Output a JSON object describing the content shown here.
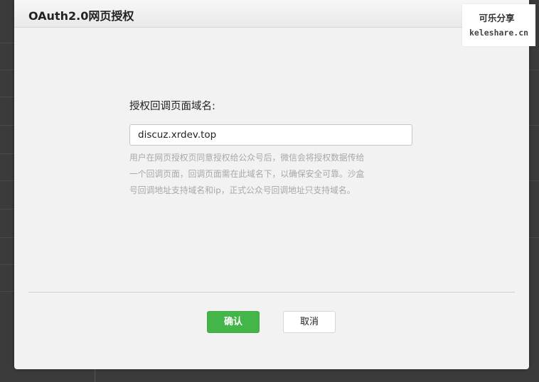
{
  "dialog": {
    "title": "OAuth2.0网页授权"
  },
  "watermark": {
    "line1": "可乐分享",
    "line2": "keleshare.cn"
  },
  "form": {
    "label": "授权回调页面域名:",
    "domain_value": "discuz.xrdev.top",
    "help_lines": [
      "用户在网页授权页同意授权给公众号后，微信会将授权数据传给",
      "一个回调页面，回调页面需在此域名下，以确保安全可靠。沙盒",
      "号回调地址支持域名和ip，正式公众号回调地址只支持域名。"
    ]
  },
  "footer": {
    "confirm_label": "确认",
    "cancel_label": "取消"
  },
  "colors": {
    "primary_green": "#44b549",
    "overlay": "#3b3b3b",
    "dialog_bg": "#f2f2f2"
  }
}
